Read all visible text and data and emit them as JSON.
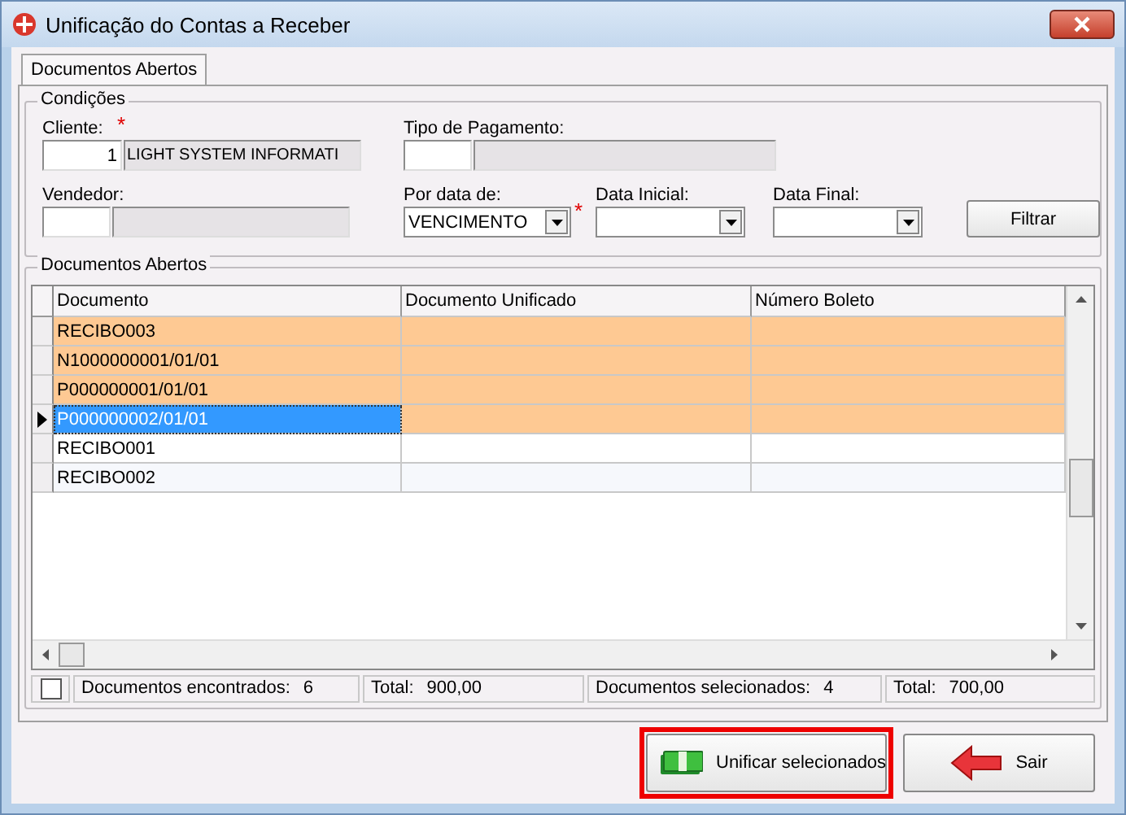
{
  "window": {
    "title": "Unificação do Contas a Receber"
  },
  "tabs": [
    {
      "label": "Documentos Abertos",
      "selected": true
    }
  ],
  "conditions": {
    "title": "Condições",
    "rows": [
      [
        {
          "kind": "lookup",
          "label": "Cliente:",
          "code": "1",
          "name": "LIGHT SYSTEM INFORMATI",
          "required_mark": "*"
        },
        {
          "kind": "lookup",
          "label": "Tipo de Pagamento:"
        }
      ],
      [
        {
          "kind": "lookup",
          "label": "Vendedor:"
        },
        {
          "kind": "combo",
          "label": "Por data de:",
          "value": "VENCIMENTO",
          "required_mark": "*"
        },
        {
          "kind": "date",
          "label": "Data Inicial:"
        },
        {
          "kind": "date",
          "label": "Data Final:"
        },
        {
          "kind": "button",
          "label": "Filtrar"
        }
      ]
    ]
  },
  "grid": {
    "title": "Documentos Abertos",
    "columns": [
      "Documento",
      "Documento Unificado",
      "Número Boleto"
    ],
    "rows": [
      {
        "documento": "RECIBO003",
        "selected": true,
        "current": false
      },
      {
        "documento": "N1000000001/01/01",
        "selected": true,
        "current": false
      },
      {
        "documento": "P000000001/01/01",
        "selected": true,
        "current": false
      },
      {
        "documento": "P000000002/01/01",
        "selected": true,
        "current": true
      },
      {
        "documento": "RECIBO001",
        "selected": false,
        "current": false
      },
      {
        "documento": "RECIBO002",
        "selected": false,
        "current": false
      }
    ]
  },
  "status_bar": {
    "checked": false,
    "items": [
      {
        "label": "Documentos encontrados:",
        "value": "6"
      },
      {
        "label": "Total:",
        "value": "900,00"
      },
      {
        "label": "Documentos selecionados:",
        "value": "4"
      },
      {
        "label": "Total:",
        "value": "700,00"
      }
    ]
  },
  "buttons": [
    {
      "kind": "unify",
      "label": "Unificar selecionados",
      "highlighted": true
    },
    {
      "kind": "exit",
      "label": "Sair",
      "highlighted": false
    }
  ]
}
